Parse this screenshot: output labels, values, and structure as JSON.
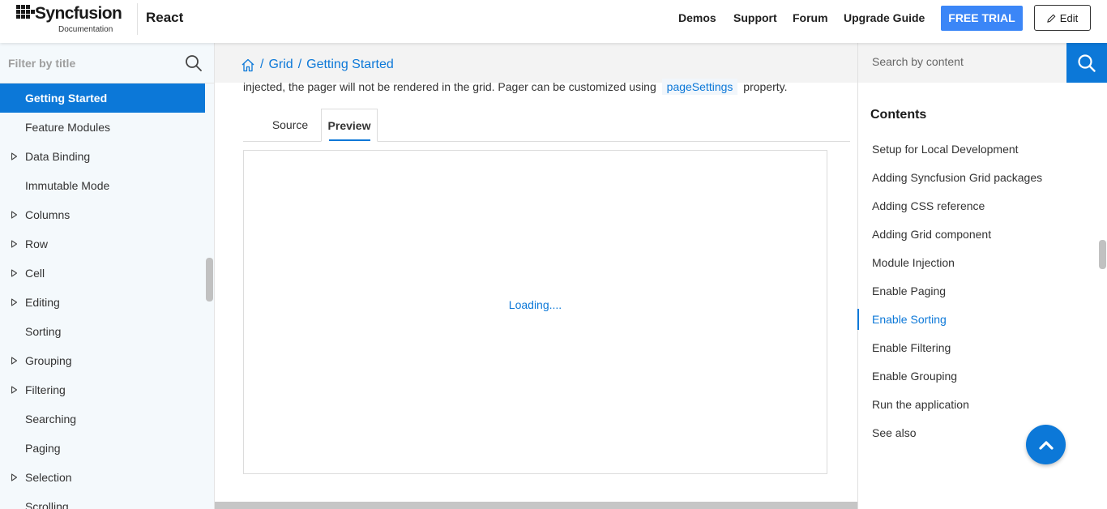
{
  "header": {
    "logo_text": "Syncfusion",
    "logo_sub": "Documentation",
    "product": "React",
    "nav": [
      "Demos",
      "Support",
      "Forum",
      "Upgrade Guide"
    ],
    "trial_label": "FREE TRIAL",
    "edit_label": "Edit",
    "accent_color": "#3b86f7"
  },
  "sidebar": {
    "filter_placeholder": "Filter by title",
    "items": [
      {
        "label": "Getting Started",
        "expandable": false,
        "active": true
      },
      {
        "label": "Feature Modules",
        "expandable": false
      },
      {
        "label": "Data Binding",
        "expandable": true
      },
      {
        "label": "Immutable Mode",
        "expandable": false
      },
      {
        "label": "Columns",
        "expandable": true
      },
      {
        "label": "Row",
        "expandable": true
      },
      {
        "label": "Cell",
        "expandable": true
      },
      {
        "label": "Editing",
        "expandable": true
      },
      {
        "label": "Sorting",
        "expandable": false
      },
      {
        "label": "Grouping",
        "expandable": true
      },
      {
        "label": "Filtering",
        "expandable": true
      },
      {
        "label": "Searching",
        "expandable": false
      },
      {
        "label": "Paging",
        "expandable": false
      },
      {
        "label": "Selection",
        "expandable": true
      },
      {
        "label": "Scrolling",
        "expandable": false
      }
    ]
  },
  "breadcrumb": {
    "separator": "/",
    "items": [
      "Grid",
      "Getting Started"
    ]
  },
  "main": {
    "para_before": "injected, the pager will not be rendered in the grid. Pager can be customized using",
    "code": "pageSettings",
    "para_after": "property.",
    "tabs": [
      {
        "label": "Source",
        "active": false
      },
      {
        "label": "Preview",
        "active": true
      }
    ],
    "loading_text": "Loading...."
  },
  "right": {
    "search_placeholder": "Search by content",
    "contents_title": "Contents",
    "toc": [
      {
        "label": "Setup for Local Development"
      },
      {
        "label": "Adding Syncfusion Grid packages"
      },
      {
        "label": "Adding CSS reference"
      },
      {
        "label": "Adding Grid component"
      },
      {
        "label": "Module Injection"
      },
      {
        "label": "Enable Paging"
      },
      {
        "label": "Enable Sorting",
        "active": true
      },
      {
        "label": "Enable Filtering"
      },
      {
        "label": "Enable Grouping"
      },
      {
        "label": "Run the application"
      },
      {
        "label": "See also"
      }
    ]
  },
  "icons": [
    "grid-logo-icon",
    "pencil-icon",
    "search-icon",
    "home-icon",
    "expand-triangle-icon",
    "chevron-up-icon"
  ],
  "colors": {
    "primary": "#0c78d8",
    "sidebar_bg": "#f4f9fc"
  }
}
